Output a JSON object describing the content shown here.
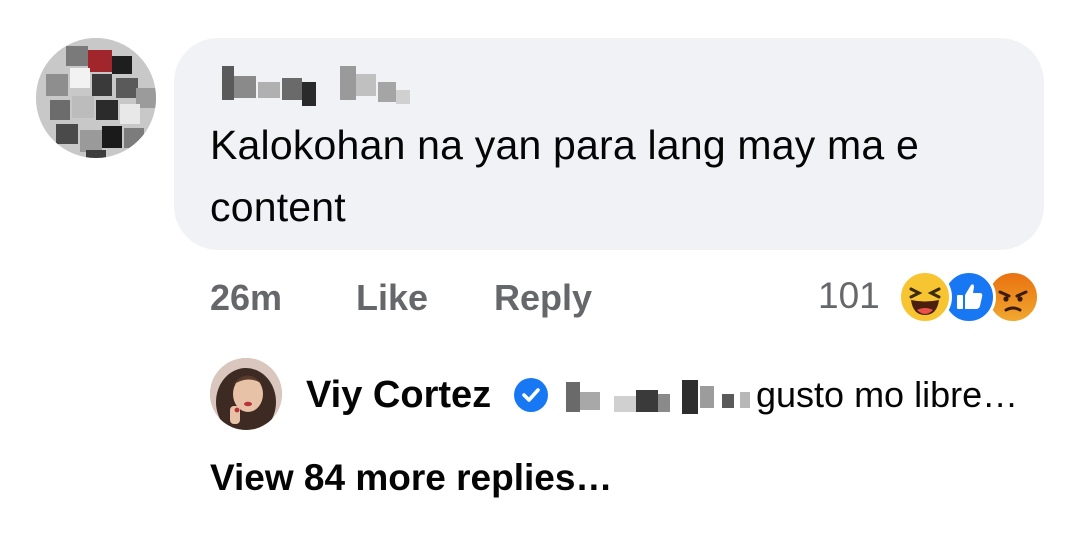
{
  "comment": {
    "text": "Kalokohan na yan para lang may ma e content",
    "time": "26m",
    "like_label": "Like",
    "reply_label": "Reply",
    "reaction_count": "101",
    "reactions": [
      "haha-icon",
      "like-icon",
      "angry-icon"
    ]
  },
  "reply_preview": {
    "author": "Viy Cortez",
    "text": "gusto mo libre…",
    "verified": true
  },
  "view_more_label": "View 84 more replies…",
  "colors": {
    "bubble_bg": "#f0f2f5",
    "meta_text": "#65676b",
    "primary_text": "#050505",
    "verified_blue": "#1877f2",
    "haha_yellow": "#f7c531",
    "angry_orange": "#e9710f"
  }
}
